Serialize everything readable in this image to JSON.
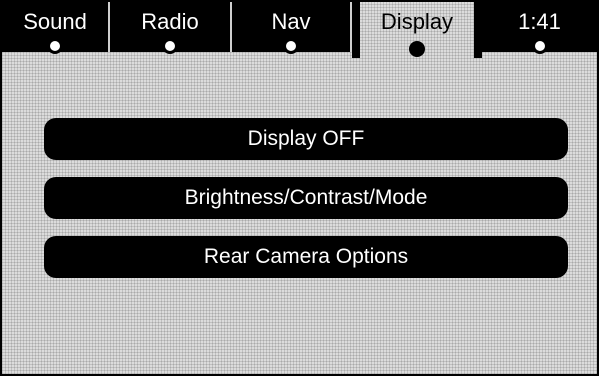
{
  "tabs": [
    {
      "label": "Sound",
      "active": false
    },
    {
      "label": "Radio",
      "active": false
    },
    {
      "label": "Nav",
      "active": false
    },
    {
      "label": "Display",
      "active": true
    },
    {
      "label": "1:41",
      "active": false
    }
  ],
  "menu": {
    "display_off": "Display OFF",
    "brightness": "Brightness/Contrast/Mode",
    "rear_camera": "Rear Camera Options"
  }
}
